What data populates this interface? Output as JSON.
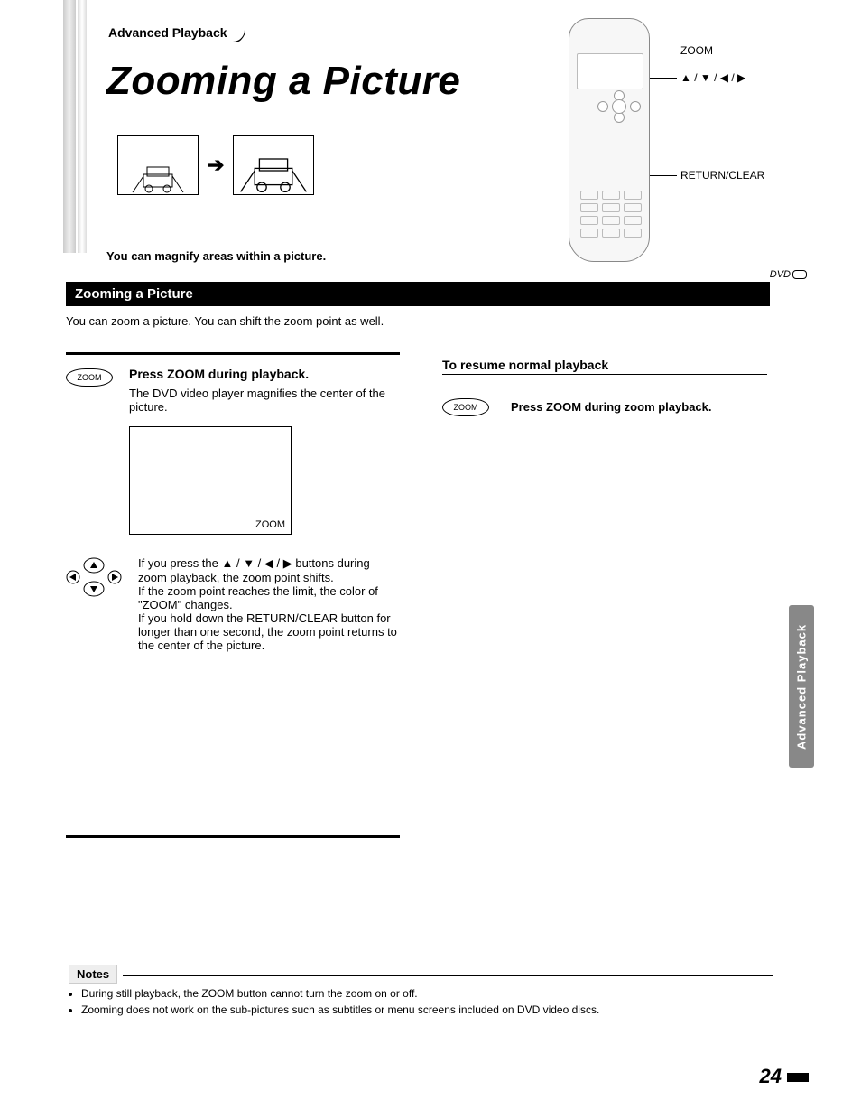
{
  "chapter": "Advanced Playback",
  "title": "Zooming a Picture",
  "subtitle": "You can magnify areas within a picture.",
  "remote_labels": {
    "zoom": "ZOOM",
    "arrows": "▲ / ▼ / ◀ / ▶",
    "return": "RETURN/CLEAR"
  },
  "disc_badge": "DVD",
  "section_heading": "Zooming a Picture",
  "intro": "You can zoom a picture. You can shift the zoom point as well.",
  "step1": {
    "button": "ZOOM",
    "heading": "Press ZOOM during playback.",
    "body": "The DVD video player magnifies the center of the picture.",
    "box_label": "ZOOM"
  },
  "step2": {
    "body": "If you press the ▲ / ▼ / ◀ / ▶ buttons during zoom playback, the zoom point shifts.\nIf the zoom point reaches the limit, the color of \"ZOOM\" changes.\nIf you hold down the RETURN/CLEAR button for longer than one second, the zoom point returns to the center of the picture."
  },
  "resume": {
    "heading": "To resume normal playback",
    "button": "ZOOM",
    "text": "Press ZOOM during zoom playback."
  },
  "side_tab": "Advanced Playback",
  "notes": {
    "heading": "Notes",
    "items": [
      "During still playback, the ZOOM button cannot turn the zoom on or off.",
      "Zooming does not work on the sub-pictures such as subtitles or menu screens included on DVD video discs."
    ]
  },
  "page_number": "24"
}
